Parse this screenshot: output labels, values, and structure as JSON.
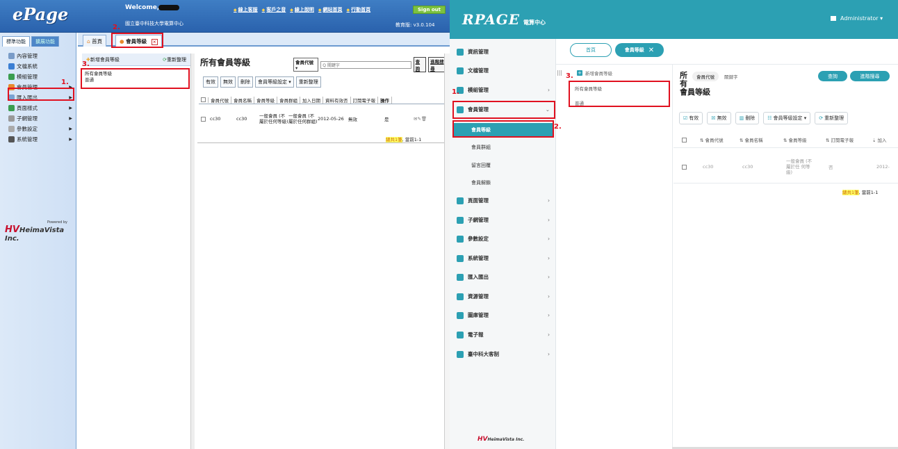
{
  "left": {
    "logo": "ePage",
    "welcome": "Welcome,",
    "school": "國立臺中科技大學電算中心",
    "links": [
      "線上客服",
      "客戶之音",
      "線上說明",
      "網站首頁",
      "行動首頁"
    ],
    "signout": "Sign out",
    "version": "教育版: v3.0.104",
    "sidetabs": [
      "標準功能",
      "擴展功能"
    ],
    "menu": [
      {
        "label": "內容管理",
        "color": "#7a9cc8",
        "arrow": ""
      },
      {
        "label": "文檔系統",
        "color": "#3b7fd4",
        "arrow": ""
      },
      {
        "label": "模組管理",
        "color": "#3a9d4f",
        "arrow": ""
      },
      {
        "label": "會員管理",
        "color": "#e88a2d",
        "arrow": "▶"
      },
      {
        "label": "匯入匯出",
        "color": "#7aa3d2",
        "arrow": "▶"
      },
      {
        "label": "頁面樣式",
        "color": "#3a9d4f",
        "arrow": "▶"
      },
      {
        "label": "子網管理",
        "color": "#999",
        "arrow": "▶"
      },
      {
        "label": "參數設定",
        "color": "#aaa",
        "arrow": "▶"
      },
      {
        "label": "系統管理",
        "color": "#555",
        "arrow": "▶"
      }
    ],
    "powered_by": "Powered by",
    "powered_company": "HeimaVista Inc.",
    "powered_hv": "HV",
    "tabs": {
      "home": "首頁",
      "member": "會員等級",
      "close": "×"
    },
    "toolbar": {
      "add": "新增會員等級",
      "refresh": "重新整理"
    },
    "tree": [
      "所有會員等級",
      "普通"
    ],
    "title": "所有會員等級",
    "filter": {
      "select": "會員代號 ▾",
      "placeholder": "Q 關鍵字",
      "query": "查詢",
      "advanced": "進階搜尋"
    },
    "actions": [
      "有效",
      "無效",
      "刪除",
      "會員等級設定 ▾",
      "重新整理"
    ],
    "columns": [
      "會員代號",
      "會員名稱",
      "會員等級",
      "會員群組",
      "加入日期",
      "資料有效否",
      "訂閱電子報",
      "操作"
    ],
    "row": {
      "code": "cc30",
      "name": "cc30",
      "level": "一般會員 (不屬於任何等級)",
      "group": "一般會員 (不屬於任何群組)",
      "date": "2012-05-26",
      "valid": "無效",
      "subscribe": "是",
      "ops": "✉✎🗑"
    },
    "total_hl": "總共1筆",
    "total_rest": ", 當前1-1"
  },
  "right": {
    "logo": "RPAGE",
    "logo_sub": "電算中心",
    "admin": "Administrator ▾",
    "menu": [
      {
        "label": "資訊管理",
        "color": "#2ca0b3",
        "arrow": ""
      },
      {
        "label": "文檔管理",
        "color": "#2ca0b3",
        "arrow": ""
      },
      {
        "label": "模組管理",
        "color": "#2ca0b3",
        "arrow": "›"
      },
      {
        "label": "會員管理",
        "color": "#2ca0b3",
        "arrow": "⌄"
      }
    ],
    "submenu": [
      "會員等級",
      "會員群組",
      "留言回覆",
      "會員解鎖"
    ],
    "menu2": [
      {
        "label": "頁面管理",
        "color": "#2ca0b3",
        "arrow": "›"
      },
      {
        "label": "子網管理",
        "color": "#2ca0b3",
        "arrow": "›"
      },
      {
        "label": "參數設定",
        "color": "#2ca0b3",
        "arrow": "›"
      },
      {
        "label": "系統管理",
        "color": "#2ca0b3",
        "arrow": "›"
      },
      {
        "label": "匯入匯出",
        "color": "#2ca0b3",
        "arrow": "›"
      },
      {
        "label": "資源管理",
        "color": "#2ca0b3",
        "arrow": "›"
      },
      {
        "label": "圖庫管理",
        "color": "#2ca0b3",
        "arrow": "›"
      },
      {
        "label": "電子報",
        "color": "#2ca0b3",
        "arrow": "›"
      },
      {
        "label": "臺中科大客制",
        "color": "#2ca0b3",
        "arrow": "›"
      }
    ],
    "powered_hv": "HV",
    "powered": "HeimaVista Inc.",
    "tabs": {
      "home": "首頁",
      "member": "會員等級",
      "close": "✕"
    },
    "collapse": "|||",
    "tree": {
      "add": "新增會員等級",
      "all": "所有會員等級",
      "normal": "普通"
    },
    "title_lines": [
      "所",
      "有",
      "會員等級"
    ],
    "filter": {
      "select": "會員代號",
      "placeholder": "關鍵字",
      "query": "查詢",
      "advanced": "進階搜尋"
    },
    "actions": [
      "有效",
      "無效",
      "刪除",
      "會員等級設定 ▾",
      "重新整理"
    ],
    "columns": [
      "⇅ 會員代號",
      "⇅ 會員名稱",
      "⇅ 會員等級",
      "⇅ 訂閱電子報",
      "⇣ 加入"
    ],
    "row": {
      "code": "cc30",
      "name": "cc30",
      "level": "一般會員 (不屬於任 何等級)",
      "subscribe": "否",
      "date": "2012-"
    },
    "total_hl": "總共1筆",
    "total_rest": ", 當前1-1"
  },
  "annotations": [
    "1.",
    "2.",
    "3."
  ]
}
